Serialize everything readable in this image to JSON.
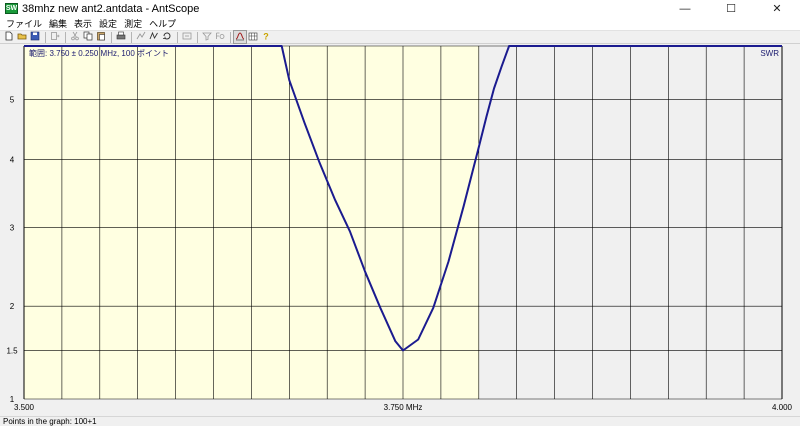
{
  "window": {
    "title": "38mhz new ant2.antdata - AntScope",
    "icon_label": "SW",
    "controls": {
      "minimize": "—",
      "maximize": "☐",
      "close": "✕"
    }
  },
  "menu": {
    "items": [
      "ファイル",
      "編集",
      "表示",
      "設定",
      "測定",
      "ヘルプ"
    ]
  },
  "toolbar": {
    "buttons": [
      {
        "name": "new-file-icon",
        "enabled": true
      },
      {
        "name": "open-folder-icon",
        "enabled": true
      },
      {
        "name": "save-disk-icon",
        "enabled": true
      },
      {
        "name": "separator"
      },
      {
        "name": "add-trace-icon",
        "enabled": false
      },
      {
        "name": "separator"
      },
      {
        "name": "cut-icon",
        "enabled": false
      },
      {
        "name": "copy-icon",
        "enabled": true
      },
      {
        "name": "paste-icon",
        "enabled": true
      },
      {
        "name": "separator"
      },
      {
        "name": "print-icon",
        "enabled": true
      },
      {
        "name": "separator"
      },
      {
        "name": "scan-icon",
        "enabled": false
      },
      {
        "name": "single-scan-icon",
        "enabled": true
      },
      {
        "name": "continuous-scan-icon",
        "enabled": true
      },
      {
        "name": "separator"
      },
      {
        "name": "fit-icon",
        "enabled": false
      },
      {
        "name": "separator"
      },
      {
        "name": "filter-icon",
        "enabled": false
      },
      {
        "name": "fq-icon",
        "enabled": false
      },
      {
        "name": "separator"
      },
      {
        "name": "swr-graph-icon",
        "enabled": true,
        "pressed": true
      },
      {
        "name": "smith-chart-icon",
        "enabled": true
      },
      {
        "name": "help-icon",
        "enabled": true
      }
    ]
  },
  "chart_data": {
    "type": "line",
    "range_label": "範囲: 3.750 ± 0.250 MHz, 100 ポイント",
    "series_label": "SWR",
    "x_ticks": [
      {
        "value": 3.5,
        "label": "3.500"
      },
      {
        "value": 3.75,
        "label": "3.750 MHz"
      },
      {
        "value": 4.0,
        "label": "4.000"
      }
    ],
    "y_ticks": [
      {
        "value": 1,
        "label": "1"
      },
      {
        "value": 1.5,
        "label": "1.5"
      },
      {
        "value": 2,
        "label": "2"
      },
      {
        "value": 3,
        "label": "3"
      },
      {
        "value": 4,
        "label": "4"
      },
      {
        "value": 5,
        "label": "5"
      }
    ],
    "xlim": [
      3.5,
      4.0
    ],
    "ylim": [
      1,
      6.0
    ],
    "y_scale": "log-like (SWR)",
    "band_highlight": [
      3.5,
      3.8
    ],
    "grid": true,
    "colors": {
      "band": "#ffffe1",
      "outside": "#f0f0f0",
      "grid": "#000000",
      "curve": "#1b1b8f"
    },
    "series": [
      {
        "name": "SWR",
        "x": [
          3.5,
          3.67,
          3.675,
          3.685,
          3.695,
          3.705,
          3.715,
          3.725,
          3.735,
          3.745,
          3.75,
          3.76,
          3.77,
          3.78,
          3.79,
          3.8,
          3.805,
          3.81,
          3.815,
          3.82,
          3.825,
          4.0
        ],
        "y": [
          6.0,
          6.0,
          5.35,
          4.6,
          3.95,
          3.4,
          2.95,
          2.42,
          1.98,
          1.6,
          1.5,
          1.62,
          1.98,
          2.55,
          3.3,
          4.2,
          4.7,
          5.2,
          5.6,
          6.0,
          6.0,
          6.0
        ]
      }
    ]
  },
  "status": {
    "text": "Points in the graph: 100+1"
  }
}
